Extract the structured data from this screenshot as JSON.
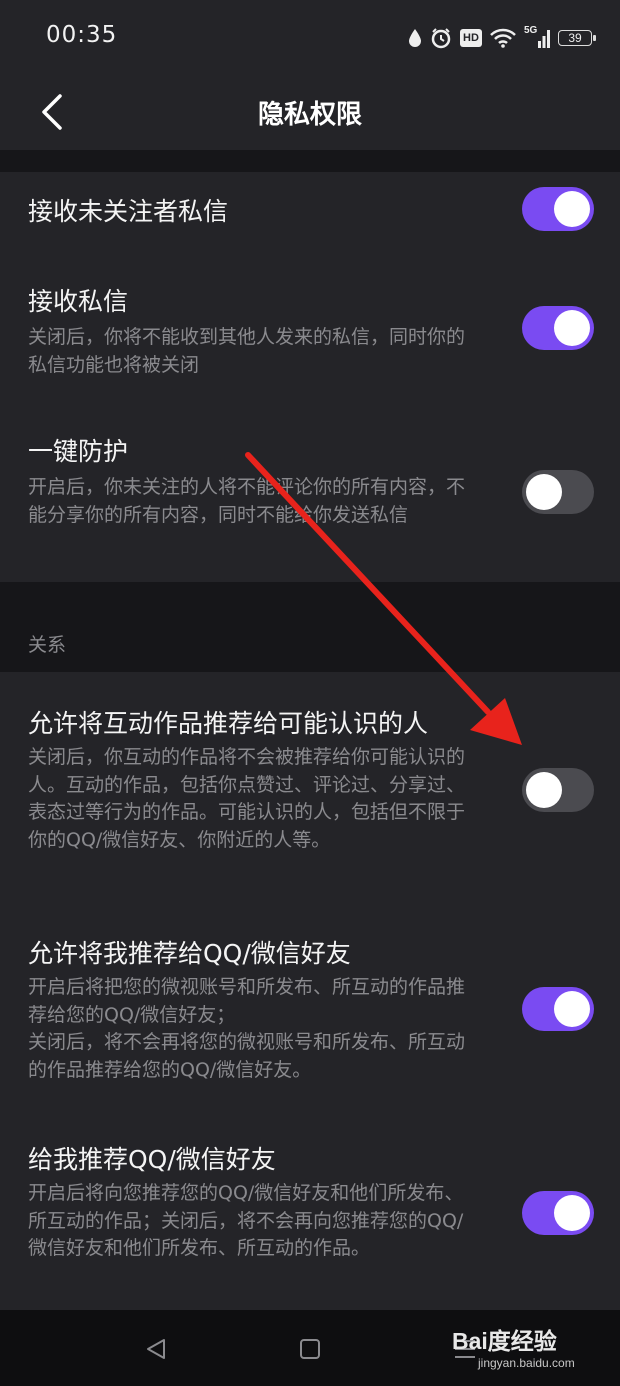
{
  "status_bar": {
    "time": "00:35",
    "battery": "39",
    "network": "5G",
    "hd_label": "HD",
    "icons": [
      "water-drop-icon",
      "alarm-icon",
      "hd-icon",
      "wifi-icon",
      "signal-5g-icon",
      "battery-icon"
    ]
  },
  "header": {
    "back_icon": "chevron-left-icon",
    "title": "隐私权限"
  },
  "settings": [
    {
      "title": "接收未关注者私信",
      "description": "",
      "enabled": true
    },
    {
      "title": "接收私信",
      "description": "关闭后，你将不能收到其他人发来的私信，同时你的私信功能也将被关闭",
      "enabled": true
    },
    {
      "title": "一键防护",
      "description": "开启后，你未关注的人将不能评论你的所有内容，不能分享你的所有内容，同时不能给你发送私信",
      "enabled": false
    }
  ],
  "relationship_section": {
    "header": "关系",
    "items": [
      {
        "title": "允许将互动作品推荐给可能认识的人",
        "description": "关闭后，你互动的作品将不会被推荐给你可能认识的人。互动的作品，包括你点赞过、评论过、分享过、表态过等行为的作品。可能认识的人，包括但不限于你的QQ/微信好友、你附近的人等。",
        "enabled": false
      },
      {
        "title": "允许将我推荐给QQ/微信好友",
        "description": "开启后将把您的微视账号和所发布、所互动的作品推荐给您的QQ/微信好友；\n关闭后，将不会再将您的微视账号和所发布、所互动的作品推荐给您的QQ/微信好友。",
        "enabled": true
      },
      {
        "title": "给我推荐QQ/微信好友",
        "description": "开启后将向您推荐您的QQ/微信好友和他们所发布、所互动的作品；关闭后，将不会再向您推荐您的QQ/微信好友和他们所发布、所互动的作品。",
        "enabled": true
      }
    ]
  },
  "bottom_nav": {
    "buttons": [
      "back-triangle-icon",
      "home-square-icon",
      "menu-lines-icon"
    ]
  },
  "watermark": {
    "logo": "Bai度经验",
    "url": "jingyan.baidu.com"
  },
  "colors": {
    "background": "#161619",
    "card": "#242428",
    "toggle_on": "#7a4bf2",
    "toggle_off": "#4b4b50",
    "arrow": "#e8231c"
  }
}
